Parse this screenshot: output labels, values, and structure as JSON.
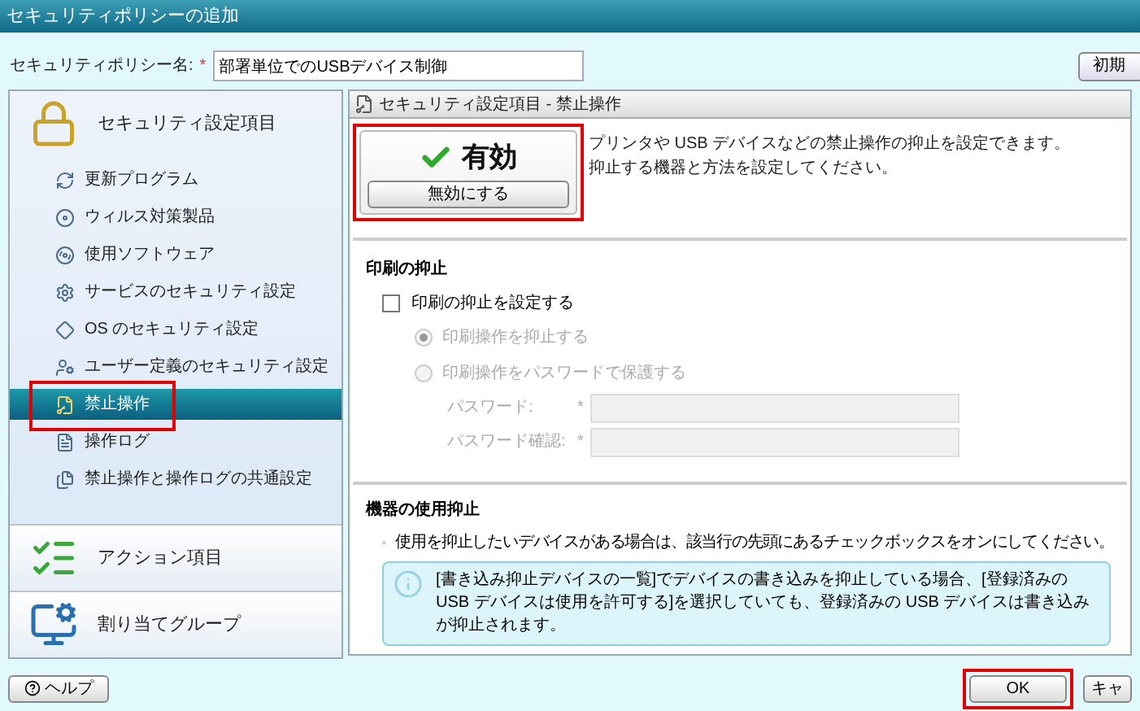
{
  "window": {
    "title": "セキュリティポリシーの追加"
  },
  "policy_name": {
    "label": "セキュリティポリシー名:",
    "required_mark": "*",
    "value": "部署単位でのUSBデバイス制御"
  },
  "reset_button": "初期",
  "sidebar": {
    "sections": [
      {
        "title": "セキュリティ設定項目",
        "kind": "lock",
        "items": [
          {
            "label": "更新プログラム",
            "kind": "refresh",
            "selected": false,
            "highlighted": false
          },
          {
            "label": "ウィルス対策製品",
            "kind": "disk",
            "selected": false,
            "highlighted": false
          },
          {
            "label": "使用ソフトウェア",
            "kind": "cd",
            "selected": false,
            "highlighted": false
          },
          {
            "label": "サービスのセキュリティ設定",
            "kind": "gear",
            "selected": false,
            "highlighted": false
          },
          {
            "label": "OS のセキュリティ設定",
            "kind": "diamond",
            "selected": false,
            "highlighted": false
          },
          {
            "label": "ユーザー定義のセキュリティ設定",
            "kind": "user",
            "selected": false,
            "highlighted": false
          },
          {
            "label": "禁止操作",
            "kind": "key",
            "selected": true,
            "highlighted": true
          },
          {
            "label": "操作ログ",
            "kind": "log",
            "selected": false,
            "highlighted": false
          },
          {
            "label": "禁止操作と操作ログの共通設定",
            "kind": "files",
            "selected": false,
            "highlighted": false
          }
        ]
      },
      {
        "title": "アクション項目",
        "kind": "action"
      },
      {
        "title": "割り当てグループ",
        "kind": "group"
      }
    ]
  },
  "panel": {
    "title": "セキュリティ設定項目 - 禁止操作",
    "status": {
      "enabled": true,
      "label": "有効",
      "button": "無効にする",
      "highlighted": true
    },
    "description": [
      "プリンタや USB デバイスなどの禁止操作の抑止を設定できます。",
      "抑止する機器と方法を設定してください。"
    ],
    "print_section": {
      "title": "印刷の抑止",
      "checkbox": {
        "label": "印刷の抑止を設定する",
        "checked": false
      },
      "radios": [
        {
          "label": "印刷操作を抑止する",
          "selected": true,
          "disabled": true
        },
        {
          "label": "印刷操作をパスワードで保護する",
          "selected": false,
          "disabled": true
        }
      ],
      "fields": [
        {
          "label": "パスワード:",
          "required_mark": "*",
          "disabled": true
        },
        {
          "label": "パスワード確認:",
          "required_mark": "*",
          "disabled": true
        }
      ]
    },
    "device_section": {
      "title": "機器の使用抑止",
      "note": "使用を抑止したいデバイスがある場合は、該当行の先頭にあるチェックボックスをオンにしてください。",
      "info": "[書き込み抑止デバイスの一覧]でデバイスの書き込みを抑止している場合、[登録済みの USB デバイスは使用を許可する]を選択していても、登録済みの USB デバイスは書き込みが抑止されます。"
    }
  },
  "footer": {
    "help_button": "ヘルプ",
    "buttons": [
      {
        "label": "OK",
        "highlighted": true
      },
      {
        "label": "キャ",
        "highlighted": false
      }
    ]
  }
}
